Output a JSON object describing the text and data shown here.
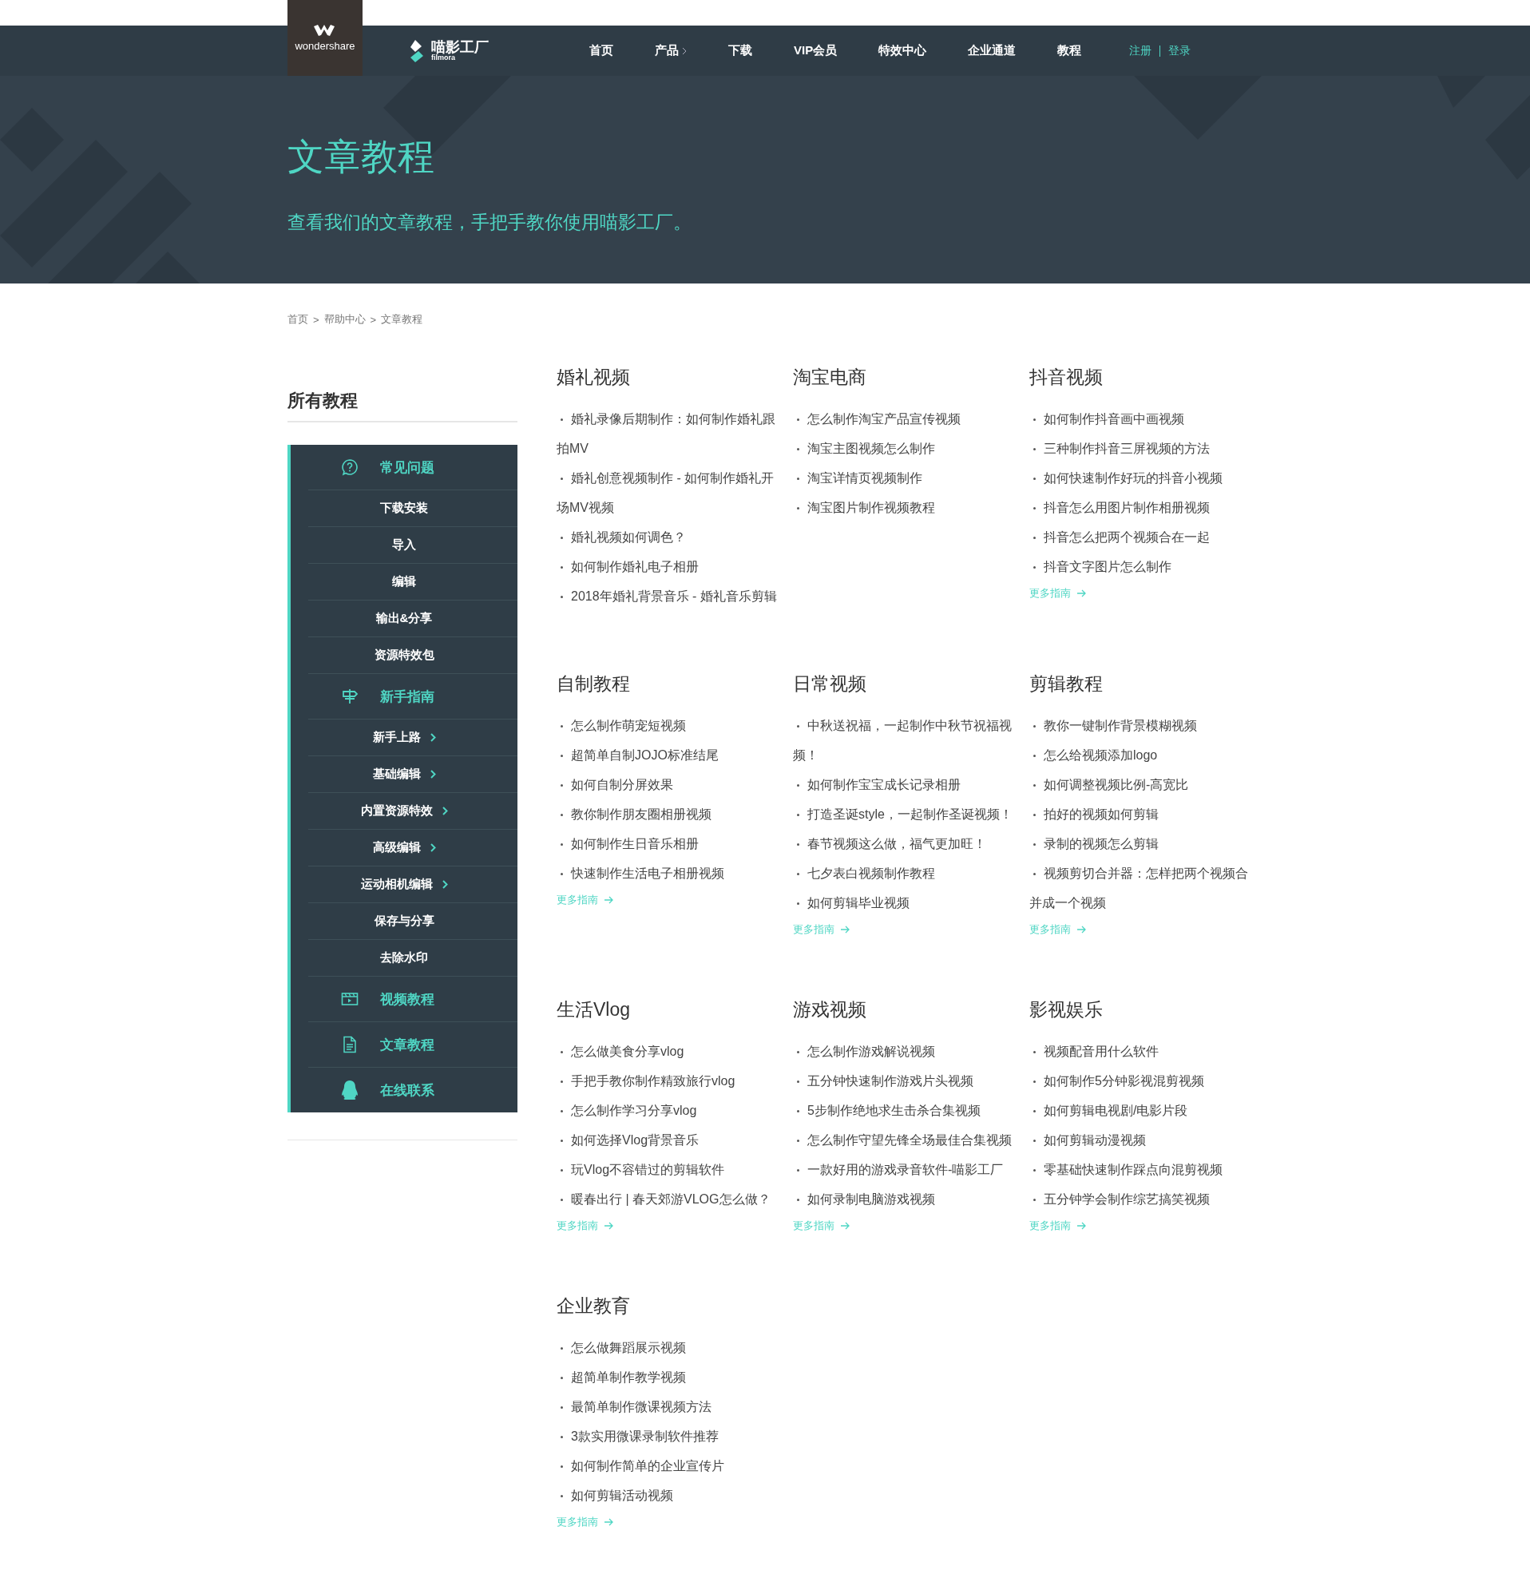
{
  "header": {
    "brand": "wondershare",
    "product": "喵影工厂",
    "product_sub": "filmora",
    "nav": [
      {
        "label": "首页",
        "has_menu": false
      },
      {
        "label": "产品",
        "has_menu": true
      },
      {
        "label": "下载",
        "has_menu": false
      },
      {
        "label": "VIP会员",
        "has_menu": false
      },
      {
        "label": "特效中心",
        "has_menu": false
      },
      {
        "label": "企业通道",
        "has_menu": false
      },
      {
        "label": "教程",
        "has_menu": false
      }
    ],
    "account": [
      "注册",
      "登录"
    ]
  },
  "hero": {
    "title": "文章教程",
    "subtitle": "查看我们的文章教程，手把手教你使用喵影工厂。"
  },
  "breadcrumb": [
    {
      "label": "首页"
    },
    {
      "separator": ">",
      "label": "帮助中心"
    },
    {
      "separator": ">",
      "label": "文章教程"
    }
  ],
  "sidebar": {
    "title": "所有教程",
    "items": [
      {
        "kind": "section",
        "label": "常见问题"
      },
      {
        "kind": "item",
        "label": "下载安装",
        "has_children": false
      },
      {
        "kind": "item",
        "label": "导入",
        "has_children": false
      },
      {
        "kind": "item",
        "label": "编辑",
        "has_children": false
      },
      {
        "kind": "item",
        "label": "输出&分享",
        "has_children": false
      },
      {
        "kind": "item",
        "label": "资源特效包",
        "has_children": false
      },
      {
        "kind": "section",
        "label": "新手指南"
      },
      {
        "kind": "item",
        "label": "新手上路",
        "has_children": true
      },
      {
        "kind": "item",
        "label": "基础编辑",
        "has_children": true
      },
      {
        "kind": "item",
        "label": "内置资源特效",
        "has_children": true
      },
      {
        "kind": "item",
        "label": "高级编辑",
        "has_children": true
      },
      {
        "kind": "item",
        "label": "运动相机编辑",
        "has_children": true
      },
      {
        "kind": "item",
        "label": "保存与分享",
        "has_children": false
      },
      {
        "kind": "item",
        "label": "去除水印",
        "has_children": false
      },
      {
        "kind": "section",
        "label": "视频教程"
      },
      {
        "kind": "section",
        "label": "文章教程"
      },
      {
        "kind": "section",
        "label": "在线联系"
      }
    ]
  },
  "sections": [
    {
      "title": "婚礼视频",
      "items": [
        "婚礼录像后期制作：如何制作婚礼跟拍MV",
        "婚礼创意视频制作 - 如何制作婚礼开场MV视频",
        "婚礼视频如何调色？",
        "如何制作婚礼电子相册",
        "2018年婚礼背景音乐 - 婚礼音乐剪辑"
      ]
    },
    {
      "title": "淘宝电商",
      "items": [
        "怎么制作淘宝产品宣传视频",
        "淘宝主图视频怎么制作",
        "淘宝详情页视频制作",
        "淘宝图片制作视频教程"
      ]
    },
    {
      "title": "抖音视频",
      "items": [
        "如何制作抖音画中画视频",
        "三种制作抖音三屏视频的方法",
        "如何快速制作好玩的抖音小视频",
        "抖音怎么用图片制作相册视频",
        "抖音怎么把两个视频合在一起",
        "抖音文字图片怎么制作"
      ],
      "more": "更多指南"
    },
    {
      "title": "自制教程",
      "items": [
        "怎么制作萌宠短视频",
        "超简单自制JOJO标准结尾",
        "如何自制分屏效果",
        "教你制作朋友圈相册视频",
        "如何制作生日音乐相册",
        "快速制作生活电子相册视频"
      ],
      "more": "更多指南"
    },
    {
      "title": "日常视频",
      "items": [
        "中秋送祝福，一起制作中秋节祝福视频！",
        "如何制作宝宝成长记录相册",
        "打造圣诞style，一起制作圣诞视频！",
        "春节视频这么做，福气更加旺！",
        "七夕表白视频制作教程",
        "如何剪辑毕业视频"
      ],
      "more": "更多指南"
    },
    {
      "title": "剪辑教程",
      "items": [
        "教你一键制作背景模糊视频",
        "怎么给视频添加logo",
        "如何调整视频比例-高宽比",
        "拍好的视频如何剪辑",
        "录制的视频怎么剪辑",
        "视频剪切合并器：怎样把两个视频合并成一个视频"
      ],
      "more": "更多指南"
    },
    {
      "title": "生活Vlog",
      "items": [
        "怎么做美食分享vlog",
        "手把手教你制作精致旅行vlog",
        "怎么制作学习分享vlog",
        "如何选择Vlog背景音乐",
        "玩Vlog不容错过的剪辑软件",
        "暖春出行 | 春天郊游VLOG怎么做？"
      ],
      "more": "更多指南"
    },
    {
      "title": "游戏视频",
      "items": [
        "怎么制作游戏解说视频",
        "五分钟快速制作游戏片头视频",
        "5步制作绝地求生击杀合集视频",
        "怎么制作守望先锋全场最佳合集视频",
        "一款好用的游戏录音软件-喵影工厂",
        "如何录制电脑游戏视频"
      ],
      "more": "更多指南"
    },
    {
      "title": "影视娱乐",
      "items": [
        "视频配音用什么软件",
        "如何制作5分钟影视混剪视频",
        "如何剪辑电视剧/电影片段",
        "如何剪辑动漫视频",
        "零基础快速制作踩点向混剪视频",
        "五分钟学会制作综艺搞笑视频"
      ],
      "more": "更多指南"
    },
    {
      "title": "企业教育",
      "items": [
        "怎么做舞蹈展示视频",
        "超简单制作教学视频",
        "最简单制作微课视频方法",
        "3款实用微课录制软件推荐",
        "如何制作简单的企业宣传片",
        "如何剪辑活动视频"
      ],
      "more": "更多指南"
    }
  ]
}
